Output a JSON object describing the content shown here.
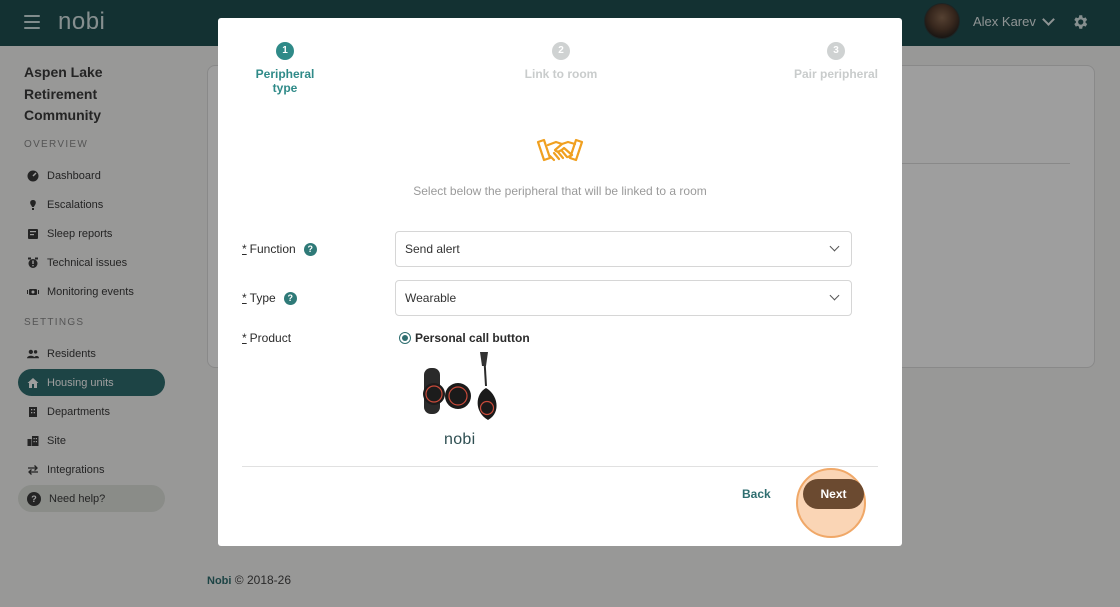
{
  "header": {
    "logo": "nobi",
    "user_name": "Alex Karev"
  },
  "sidebar": {
    "community_name": "Aspen Lake Retirement Community",
    "overview_title": "OVERVIEW",
    "overview_items": [
      {
        "label": "Dashboard",
        "icon": "dashboard-icon"
      },
      {
        "label": "Escalations",
        "icon": "escalations-icon"
      },
      {
        "label": "Sleep reports",
        "icon": "sleep-reports-icon"
      },
      {
        "label": "Technical issues",
        "icon": "technical-issues-icon"
      },
      {
        "label": "Monitoring events",
        "icon": "monitoring-events-icon"
      }
    ],
    "settings_title": "SETTINGS",
    "settings_items": [
      {
        "label": "Residents",
        "icon": "residents-icon"
      },
      {
        "label": "Housing units",
        "icon": "housing-units-icon",
        "active": true
      },
      {
        "label": "Departments",
        "icon": "departments-icon"
      },
      {
        "label": "Site",
        "icon": "site-icon"
      },
      {
        "label": "Integrations",
        "icon": "integrations-icon"
      }
    ],
    "help_label": "Need help?"
  },
  "footer": {
    "brand": "Nobi",
    "copyright": "© 2018-26"
  },
  "modal": {
    "steps": [
      {
        "number": "1",
        "label": "Peripheral type",
        "state": "active"
      },
      {
        "number": "2",
        "label": "Link to room",
        "state": "todo"
      },
      {
        "number": "3",
        "label": "Pair peripheral",
        "state": "todo"
      }
    ],
    "illustration": "handshake-icon",
    "subtitle": "Select below the peripheral that will be linked to a room",
    "fields": {
      "required_mark": "*",
      "function_label": "Function",
      "function_value": "Send alert",
      "type_label": "Type",
      "type_value": "Wearable",
      "product_label": "Product",
      "product_option": "Personal call button",
      "product_image_brand": "nobi"
    },
    "help_glyph": "?",
    "back_label": "Back",
    "next_label": "Next"
  },
  "colors": {
    "header": "#1f4f52",
    "accent": "#2f6e70",
    "next_button": "#6b4a30",
    "highlight": "#f0a868",
    "handshake": "#f0a020"
  }
}
